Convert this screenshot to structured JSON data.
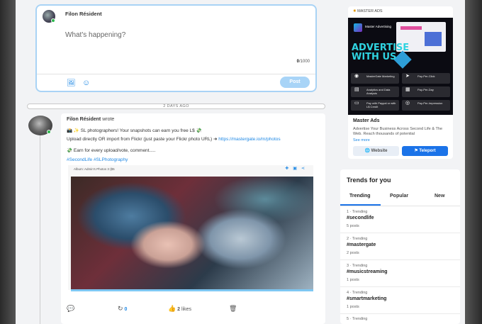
{
  "composer": {
    "user_name": "Filon Résident",
    "placeholder": "What's happening?",
    "char_count": "0",
    "char_limit": "/1000",
    "post_label": "Post"
  },
  "feed": {
    "date_separator": "2 DAYS AGO",
    "post": {
      "author": "Filon Résident",
      "verb": "wrote",
      "line1": "📸 ✨ SL photographers! Your snapshots can earn you free L$ 💸",
      "line2_text": "Upload directly OR import from Flickr (just paste your Flickr photo URL) ➜ ",
      "line2_link": "https://mastergate.io/m/photos",
      "line3": "💸 Earn for every upload/vote, comment.....",
      "hashtags": "#SecondLife #SLPhotography",
      "album_label": "Album: Admin's Photos 3 ($5",
      "actions": {
        "share_count": "0",
        "likes_count": "2",
        "likes_label": "likes"
      }
    }
  },
  "ad": {
    "tag": "MASTER ADS",
    "banner": {
      "brand": "Master Advertising",
      "headline_1": "ADVERTISE",
      "headline_2": "WITH US",
      "features": [
        {
          "label": "MasterGate Marketing",
          "icon": "megaphone-icon"
        },
        {
          "label": "Pay-Per-Click",
          "icon": "cursor-icon"
        },
        {
          "label": "Analytics and Data Analysis",
          "icon": "chart-icon"
        },
        {
          "label": "Pay-Per-Day",
          "icon": "calendar-icon"
        },
        {
          "label": "Pay with Paypal or with L$ Credit",
          "icon": "wallet-icon"
        },
        {
          "label": "Pay-Per-Impression",
          "icon": "eye-icon"
        }
      ]
    },
    "title": "Master Ads",
    "description": "Advertise Your Business Across Second Life & The Web. Reach thousands of potential",
    "see_more": "See more",
    "website_label": "Website",
    "teleport_label": "Teleport"
  },
  "trends": {
    "title": "Trends for you",
    "tabs": [
      "Trending",
      "Popular",
      "New"
    ],
    "items": [
      {
        "meta": "1 · Trending",
        "tag": "#secondlife",
        "count": "5 posts"
      },
      {
        "meta": "2 · Trending",
        "tag": "#mastergate",
        "count": "2 posts"
      },
      {
        "meta": "3 · Trending",
        "tag": "#musicstreaming",
        "count": "1 posts"
      },
      {
        "meta": "4 · Trending",
        "tag": "#smartmarketing",
        "count": "1 posts"
      },
      {
        "meta": "5 · Trending",
        "tag": "",
        "count": ""
      }
    ]
  }
}
